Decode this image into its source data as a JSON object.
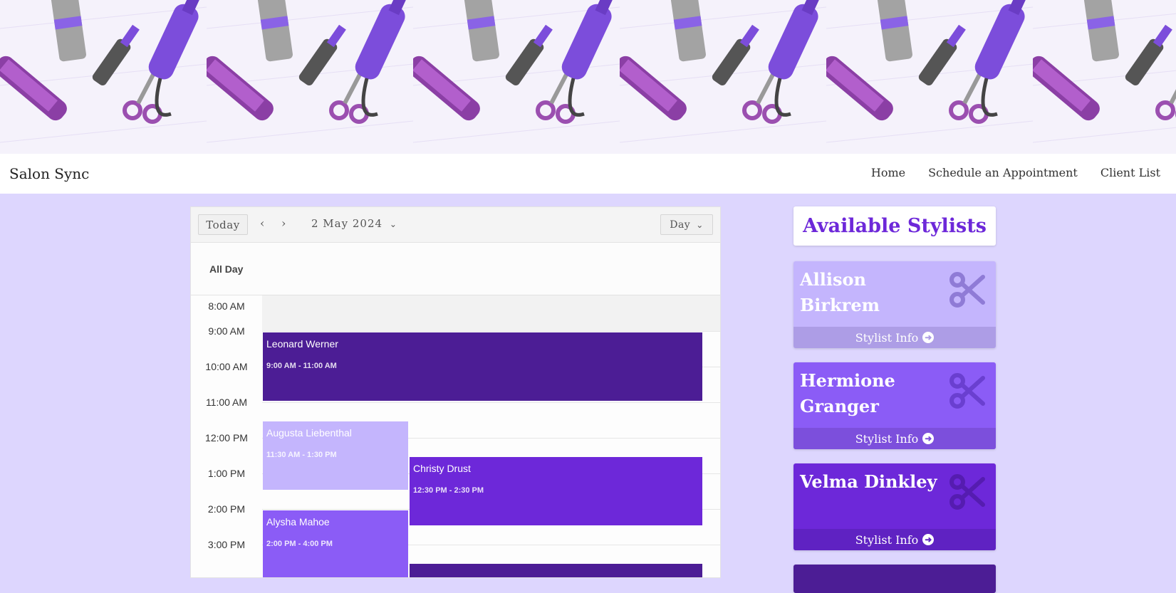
{
  "app": {
    "brand": "Salon Sync"
  },
  "nav": {
    "home": "Home",
    "schedule": "Schedule an Appointment",
    "clients": "Client List"
  },
  "calendar": {
    "today_label": "Today",
    "date_label": "2 May 2024",
    "view_label": "Day",
    "all_day_label": "All Day",
    "hours": [
      "8:00 AM",
      "9:00 AM",
      "10:00 AM",
      "11:00 AM",
      "12:00 PM",
      "1:00 PM",
      "2:00 PM",
      "3:00 PM"
    ],
    "events": [
      {
        "name": "Leonard Werner",
        "time": "9:00 AM - 11:00 AM",
        "color": "#4c1d95"
      },
      {
        "name": "Augusta Liebenthal",
        "time": "11:30 AM - 1:30 PM",
        "color": "#c4b5fd"
      },
      {
        "name": "Christy Drust",
        "time": "12:30 PM - 2:30 PM",
        "color": "#6d28d9"
      },
      {
        "name": "Alysha Mahoe",
        "time": "2:00 PM - 4:00 PM",
        "color": "#8b5cf6"
      }
    ]
  },
  "stylists": {
    "title": "Available Stylists",
    "info_label": "Stylist Info",
    "items": [
      {
        "name": "Allison Birkrem",
        "color": "#c4b5fd",
        "footer_color": "#ad9de6"
      },
      {
        "name": "Hermione Granger",
        "color": "#8b5cf6",
        "footer_color": "#7c4fdc"
      },
      {
        "name": "Velma Dinkley",
        "color": "#6d28d9",
        "footer_color": "#5f22c2"
      }
    ]
  },
  "colors": {
    "accent": "#6d28d9",
    "page_bg": "#ddd6fe"
  }
}
